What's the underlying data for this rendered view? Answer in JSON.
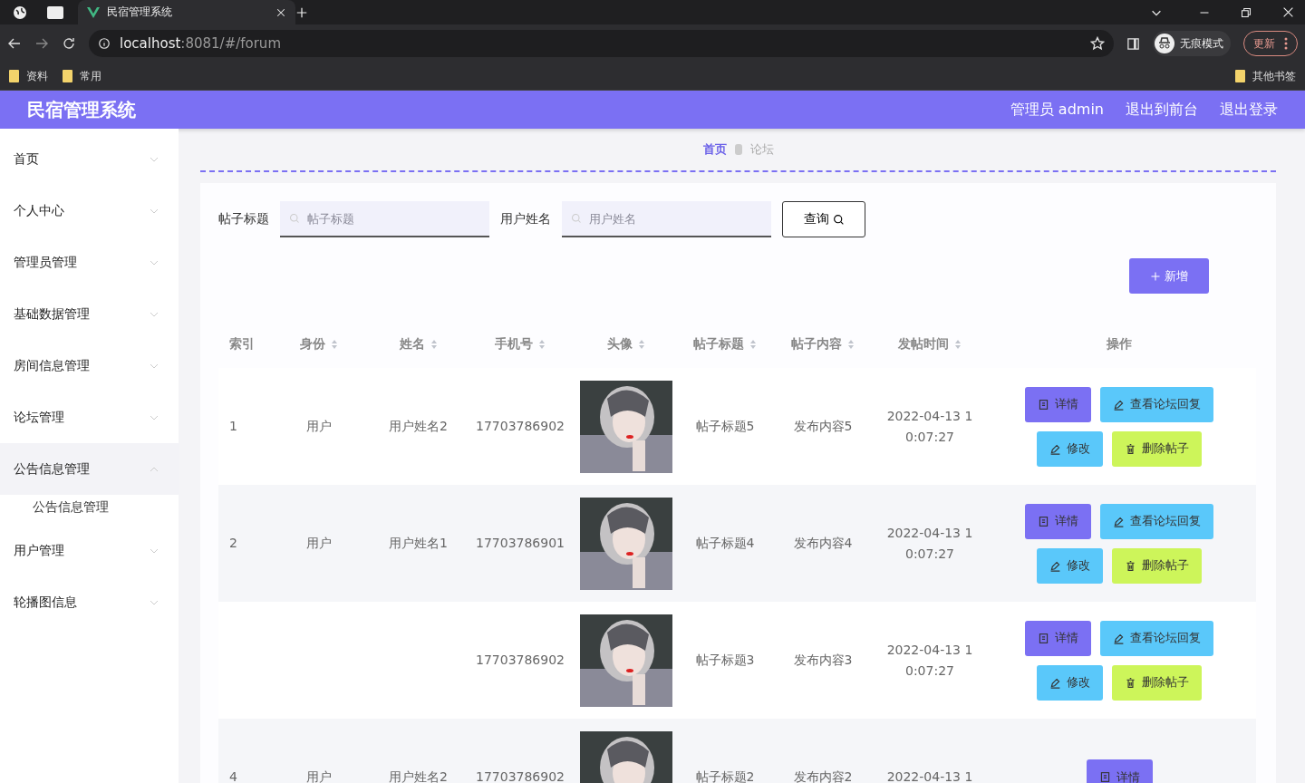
{
  "browser": {
    "tab_title": "民宿管理系统",
    "url_host": "localhost",
    "url_path": ":8081/#/forum",
    "incognito_label": "无痕模式",
    "update_label": "更新",
    "bookmarks": [
      "资料",
      "常用"
    ],
    "other_bookmarks": "其他书签"
  },
  "header": {
    "title": "民宿管理系统",
    "links": [
      "管理员 admin",
      "退出到前台",
      "退出登录"
    ]
  },
  "sidebar": {
    "items": [
      {
        "label": "首页",
        "selected": false,
        "expanded": false
      },
      {
        "label": "个人中心",
        "selected": false,
        "expanded": false
      },
      {
        "label": "管理员管理",
        "selected": false,
        "expanded": false
      },
      {
        "label": "基础数据管理",
        "selected": false,
        "expanded": false
      },
      {
        "label": "房间信息管理",
        "selected": false,
        "expanded": false
      },
      {
        "label": "论坛管理",
        "selected": false,
        "expanded": false
      },
      {
        "label": "公告信息管理",
        "selected": true,
        "expanded": true,
        "children": [
          {
            "label": "公告信息管理"
          }
        ]
      },
      {
        "label": "用户管理",
        "selected": false,
        "expanded": false
      },
      {
        "label": "轮播图信息",
        "selected": false,
        "expanded": false
      }
    ]
  },
  "breadcrumb": [
    "首页",
    "论坛"
  ],
  "search": {
    "fields": [
      {
        "label": "帖子标题",
        "placeholder": "帖子标题"
      },
      {
        "label": "用户姓名",
        "placeholder": "用户姓名"
      }
    ],
    "button": "查询"
  },
  "add_button": "新增",
  "table": {
    "columns": [
      {
        "label": "索引",
        "sortable": false
      },
      {
        "label": "身份",
        "sortable": true
      },
      {
        "label": "姓名",
        "sortable": true
      },
      {
        "label": "手机号",
        "sortable": true
      },
      {
        "label": "头像",
        "sortable": true
      },
      {
        "label": "帖子标题",
        "sortable": true
      },
      {
        "label": "帖子内容",
        "sortable": true
      },
      {
        "label": "发帖时间",
        "sortable": true
      },
      {
        "label": "操作",
        "sortable": false
      }
    ],
    "rows": [
      {
        "index": "1",
        "role": "用户",
        "name": "用户姓名2",
        "phone": "17703786902",
        "avatar": {
          "kind": "picture"
        },
        "title": "帖子标题5",
        "content": "发布内容5",
        "time": [
          "2022-04-13 1",
          "0:07:27"
        ],
        "actions": [
          {
            "kind": "detail",
            "label": "详情"
          },
          {
            "kind": "replies",
            "label": "查看论坛回复"
          },
          {
            "kind": "edit",
            "label": "修改"
          },
          {
            "kind": "delete",
            "label": "删除帖子"
          }
        ]
      },
      {
        "index": "2",
        "role": "用户",
        "name": "用户姓名1",
        "phone": "17703786901",
        "avatar": {
          "kind": "picture"
        },
        "title": "帖子标题4",
        "content": "发布内容4",
        "time": [
          "2022-04-13 1",
          "0:07:27"
        ],
        "actions": [
          {
            "kind": "detail",
            "label": "详情"
          },
          {
            "kind": "replies",
            "label": "查看论坛回复"
          },
          {
            "kind": "edit",
            "label": "修改"
          },
          {
            "kind": "delete",
            "label": "删除帖子"
          }
        ]
      },
      {
        "phone": "17703786902",
        "avatar": {
          "kind": "picture"
        },
        "title": "帖子标题3",
        "content": "发布内容3",
        "time": [
          "2022-04-13 1",
          "0:07:27"
        ],
        "actions": [
          {
            "kind": "detail",
            "label": "详情"
          },
          {
            "kind": "replies",
            "label": "查看论坛回复"
          },
          {
            "kind": "edit",
            "label": "修改"
          },
          {
            "kind": "delete",
            "label": "删除帖子"
          }
        ]
      },
      {
        "index": "4",
        "role": "用户",
        "name": "用户姓名2",
        "phone": "17703786902",
        "avatar": {
          "kind": "picture"
        },
        "title": "帖子标题2",
        "content": "发布内容2",
        "time": [
          "2022-04-13 1"
        ],
        "actions": [
          {
            "kind": "detail",
            "label": "详情"
          }
        ]
      }
    ]
  }
}
